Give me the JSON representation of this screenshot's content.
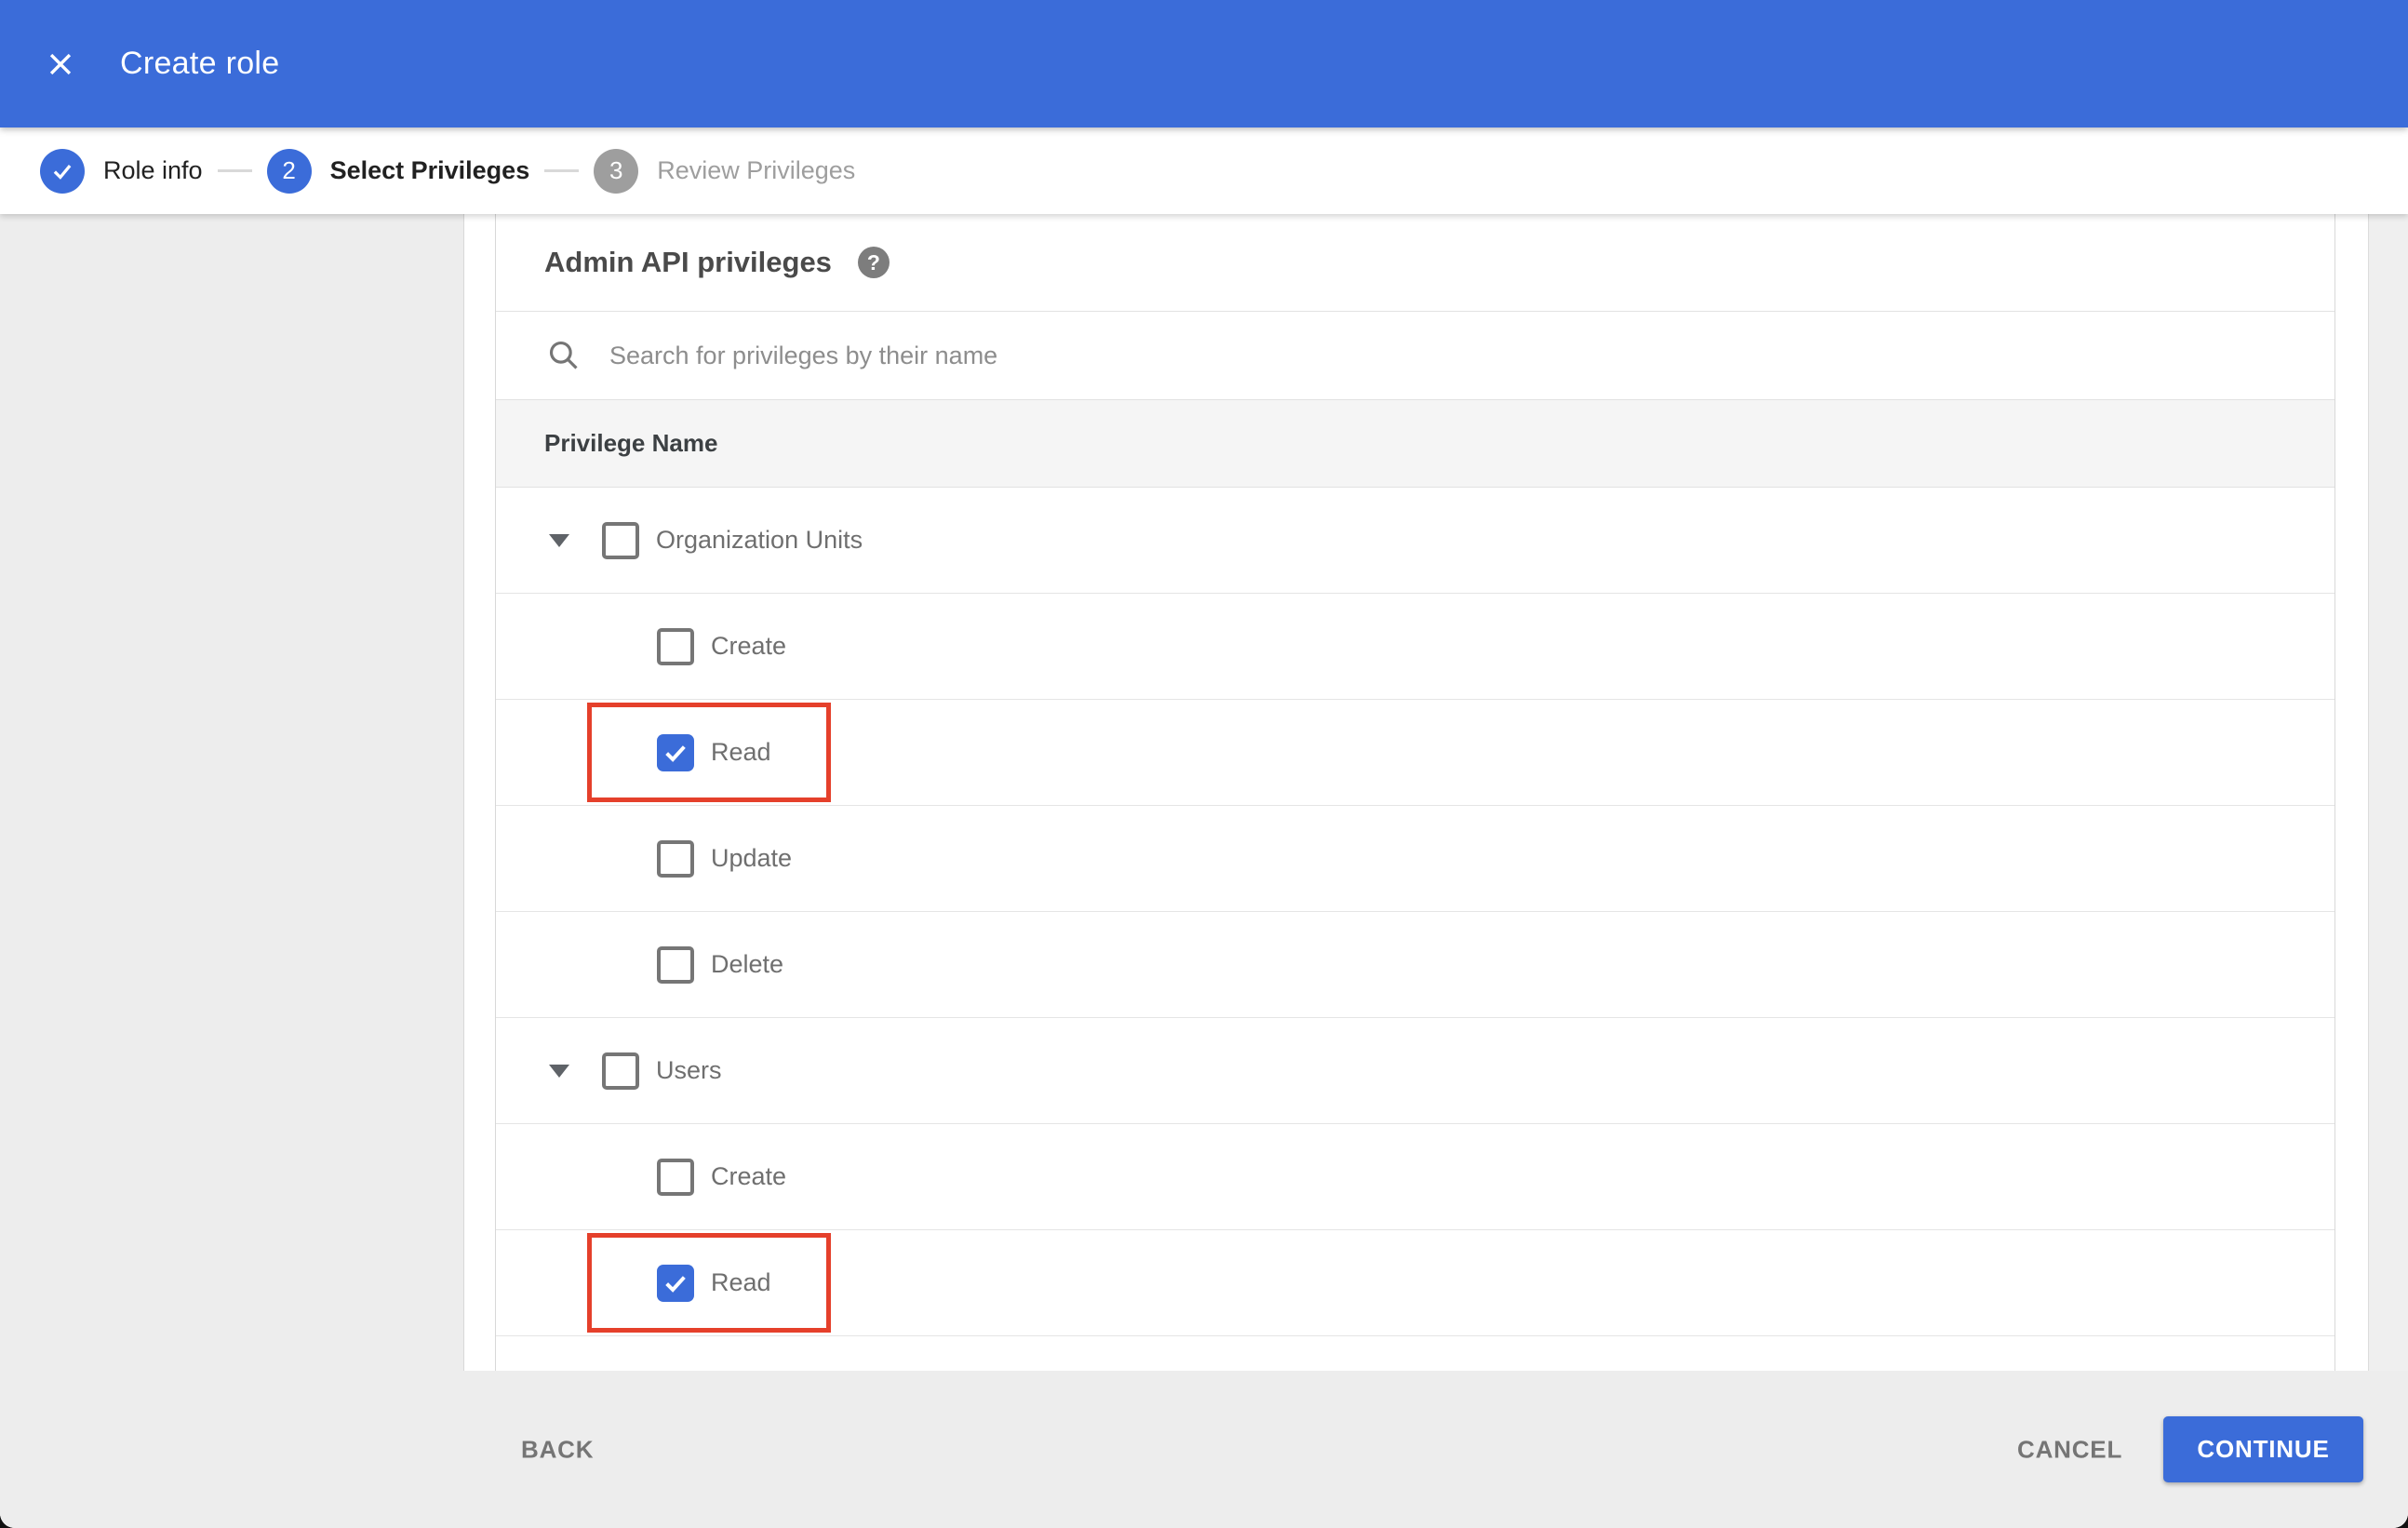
{
  "header": {
    "title": "Create role"
  },
  "stepper": {
    "steps": [
      {
        "label": "Role info",
        "state": "complete",
        "number": ""
      },
      {
        "label": "Select Privileges",
        "state": "active",
        "number": "2"
      },
      {
        "label": "Review Privileges",
        "state": "upcoming",
        "number": "3"
      }
    ]
  },
  "panel": {
    "title": "Admin API privileges",
    "help_icon_glyph": "?",
    "search": {
      "placeholder": "Search for privileges by their name",
      "value": ""
    },
    "table": {
      "column_header": "Privilege Name",
      "rows": [
        {
          "label": "Organization Units",
          "level": 0,
          "expanded": true,
          "checked": false,
          "highlighted": false
        },
        {
          "label": "Create",
          "level": 1,
          "expanded": false,
          "checked": false,
          "highlighted": false
        },
        {
          "label": "Read",
          "level": 1,
          "expanded": false,
          "checked": true,
          "highlighted": true
        },
        {
          "label": "Update",
          "level": 1,
          "expanded": false,
          "checked": false,
          "highlighted": false
        },
        {
          "label": "Delete",
          "level": 1,
          "expanded": false,
          "checked": false,
          "highlighted": false
        },
        {
          "label": "Users",
          "level": 0,
          "expanded": true,
          "checked": false,
          "highlighted": false
        },
        {
          "label": "Create",
          "level": 1,
          "expanded": false,
          "checked": false,
          "highlighted": false
        },
        {
          "label": "Read",
          "level": 1,
          "expanded": false,
          "checked": true,
          "highlighted": true
        }
      ]
    }
  },
  "footer": {
    "back_label": "BACK",
    "cancel_label": "CANCEL",
    "continue_label": "CONTINUE"
  },
  "colors": {
    "primary_blue": "#3b6cd9",
    "highlight_red": "#e5402b",
    "step_inactive_gray": "#9e9e9e"
  }
}
